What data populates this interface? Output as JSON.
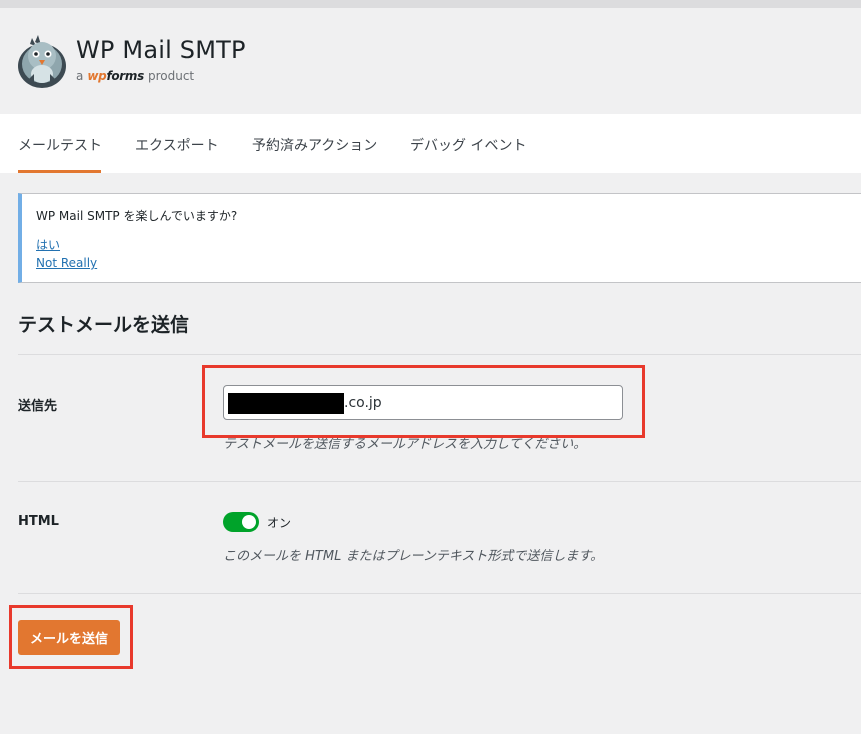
{
  "brand": {
    "title": "WP Mail SMTP",
    "sub_prefix": "a",
    "sub_wp": "wp",
    "sub_forms": "forms",
    "sub_suffix": "product"
  },
  "tabs": [
    {
      "label": "メールテスト",
      "active": true
    },
    {
      "label": "エクスポート",
      "active": false
    },
    {
      "label": "予約済みアクション",
      "active": false
    },
    {
      "label": "デバッグ イベント",
      "active": false
    }
  ],
  "notice": {
    "question": "WP Mail SMTP を楽しんでいますか?",
    "yes": "はい",
    "no": "Not Really"
  },
  "section": {
    "title": "テストメールを送信"
  },
  "send_to": {
    "label": "送信先",
    "value_suffix": ".co.jp",
    "help": "テストメールを送信するメールアドレスを入力してください。"
  },
  "html_option": {
    "label": "HTML",
    "toggle_state": "オン",
    "enabled": true,
    "help": "このメールを HTML またはプレーンテキスト形式で送信します。"
  },
  "submit": {
    "label": "メールを送信"
  },
  "colors": {
    "accent": "#e27730",
    "toggle_on": "#00a32a",
    "link": "#2271b1",
    "highlight": "#e8392c"
  }
}
